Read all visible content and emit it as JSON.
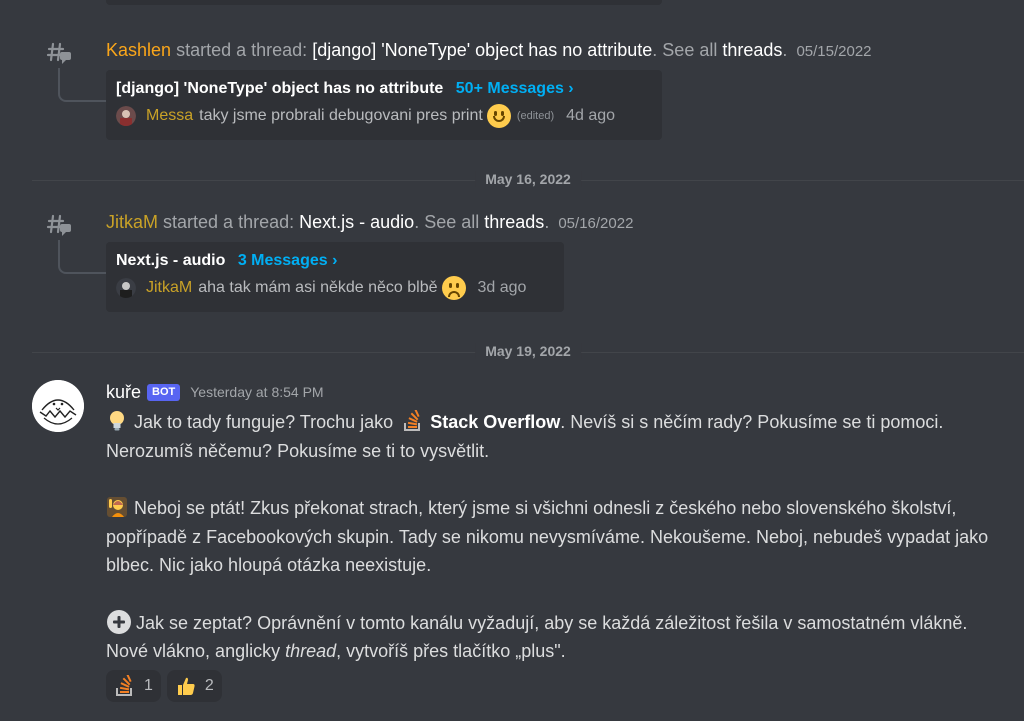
{
  "events": [
    {
      "author": "Kashlen",
      "author_color": "#faa61a",
      "action": "started a thread:",
      "thread_name": "[django] 'NoneType' object has no attribute",
      "see_all_prefix": ". See all",
      "see_all_link": "threads",
      "see_all_suffix": ".",
      "date": "05/15/2022",
      "card": {
        "title": "[django] 'NoneType' object has no attribute",
        "count": "50+ Messages ›",
        "last_author": "Messa",
        "last_author_color": "#c9a227",
        "last_text": "taky jsme probrali debugovani pres print",
        "edited": "(edited)",
        "ago": "4d ago"
      }
    },
    {
      "author": "JitkaM",
      "author_color": "#c9a227",
      "action": "started a thread:",
      "thread_name": "Next.js - audio",
      "see_all_prefix": ". See all",
      "see_all_link": "threads",
      "see_all_suffix": ".",
      "date": "05/16/2022",
      "card": {
        "title": "Next.js - audio",
        "count": "3 Messages ›",
        "last_author": "JitkaM",
        "last_author_color": "#c9a227",
        "last_text": "aha tak mám asi  někde něco blbě",
        "ago": "3d ago"
      }
    }
  ],
  "dividers": [
    "May 16, 2022",
    "May 19, 2022"
  ],
  "message": {
    "author": "kuře",
    "bot_tag": "BOT",
    "time": "Yesterday at 8:54 PM",
    "p1_a": "Jak to tady funguje? Trochu jako",
    "p1_bold": "Stack Overflow",
    "p1_b": ". Nevíš si s něčím rady? Pokusíme se ti pomoci. Nerozumíš něčemu? Pokusíme se ti to vysvětlit.",
    "p2": "Neboj se ptát! Zkus překonat strach, který jsme si všichni odnesli z českého nebo slovenského školství, popřípadě z Facebookových skupin. Tady se nikomu nevysmíváme. Nekoušeme. Neboj, nebudeš vypadat jako blbec. Nic jako hloupá otázka neexistuje.",
    "p3_a": "Jak se zeptat? Oprávnění v tomto kanálu vyžadují, aby se každá záležitost řešila v samostatném vlákně. Nové vlákno, anglicky",
    "p3_em": "thread",
    "p3_b": ", vytvoříš přes tlačítko „plus\".",
    "reactions": [
      {
        "icon": "stackoverflow-icon",
        "count": "1"
      },
      {
        "icon": "thumbs-up-icon",
        "count": "2"
      }
    ]
  },
  "colors": {
    "background": "#36393f",
    "card": "#2f3136",
    "link": "#00aff4",
    "bot_tag": "#5865f2"
  }
}
